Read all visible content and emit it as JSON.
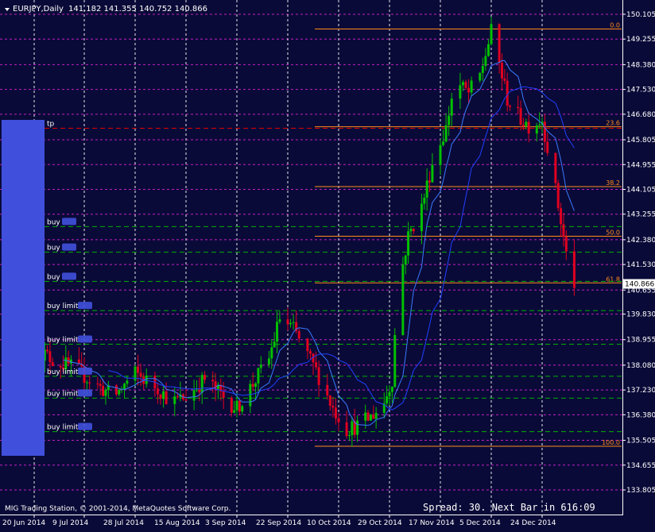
{
  "header": {
    "symbol_label": "EURJPY,Daily",
    "ohlc_label": "141.182 141.355 140.752 140.866"
  },
  "footer": {
    "copyright": "MIG Trading Station, © 2001-2014, MetaQuotes Software Corp.",
    "status": "Spread: 30. Next Bar in 616:09"
  },
  "colors": {
    "background": "#0a0a38",
    "grid": "#c020c0",
    "bull": "#00c000",
    "bear": "#e00020",
    "ma_fast": "#3a7bff",
    "ma_slow": "#2040ff",
    "fib": "#ff8c1a",
    "order_line": "#00b000",
    "tp_line": "#e00000",
    "text": "#ffffff",
    "side_panel": "#4050dd"
  },
  "side_panel": {
    "tp_label": "tp",
    "orders": [
      "buy",
      "buy",
      "buy",
      "buy limit",
      "buy limit",
      "buy limit",
      "buy limit",
      "buy limit"
    ],
    "order_prices": [
      142.83,
      141.95,
      140.95,
      139.95,
      138.8,
      137.7,
      136.95,
      135.8
    ],
    "tp_price": 146.2
  },
  "chart_data": {
    "type": "candlestick",
    "title": "EURJPY,Daily",
    "ylim": [
      133.805,
      150.5
    ],
    "y_ticks": [
      "150.105",
      "149.255",
      "148.380",
      "147.530",
      "146.680",
      "145.805",
      "144.955",
      "144.105",
      "143.255",
      "142.380",
      "141.530",
      "140.655",
      "139.830",
      "138.955",
      "138.080",
      "137.230",
      "136.380",
      "135.505",
      "134.655",
      "133.805"
    ],
    "current_price": "140.866",
    "current_price_value": 140.866,
    "x_labels": [
      "20 Jun 2014",
      "9 Jul 2014",
      "28 Jul 2014",
      "15 Aug 2014",
      "3 Sep 2014",
      "22 Sep 2014",
      "10 Oct 2014",
      "29 Oct 2014",
      "17 Nov 2014",
      "5 Dec 2014",
      "24 Dec 2014"
    ],
    "date_start": "2014-06-20",
    "date_end": "2015-01-05",
    "candles": [],
    "fibonacci": {
      "levels": [
        {
          "label": "0.0",
          "price": 149.6
        },
        {
          "label": "23.6",
          "price": 146.25
        },
        {
          "label": "38.2",
          "price": 144.2
        },
        {
          "label": "50.0",
          "price": 142.5
        },
        {
          "label": "61.8",
          "price": 140.9
        },
        {
          "label": "100.0",
          "price": 135.3
        }
      ]
    }
  }
}
